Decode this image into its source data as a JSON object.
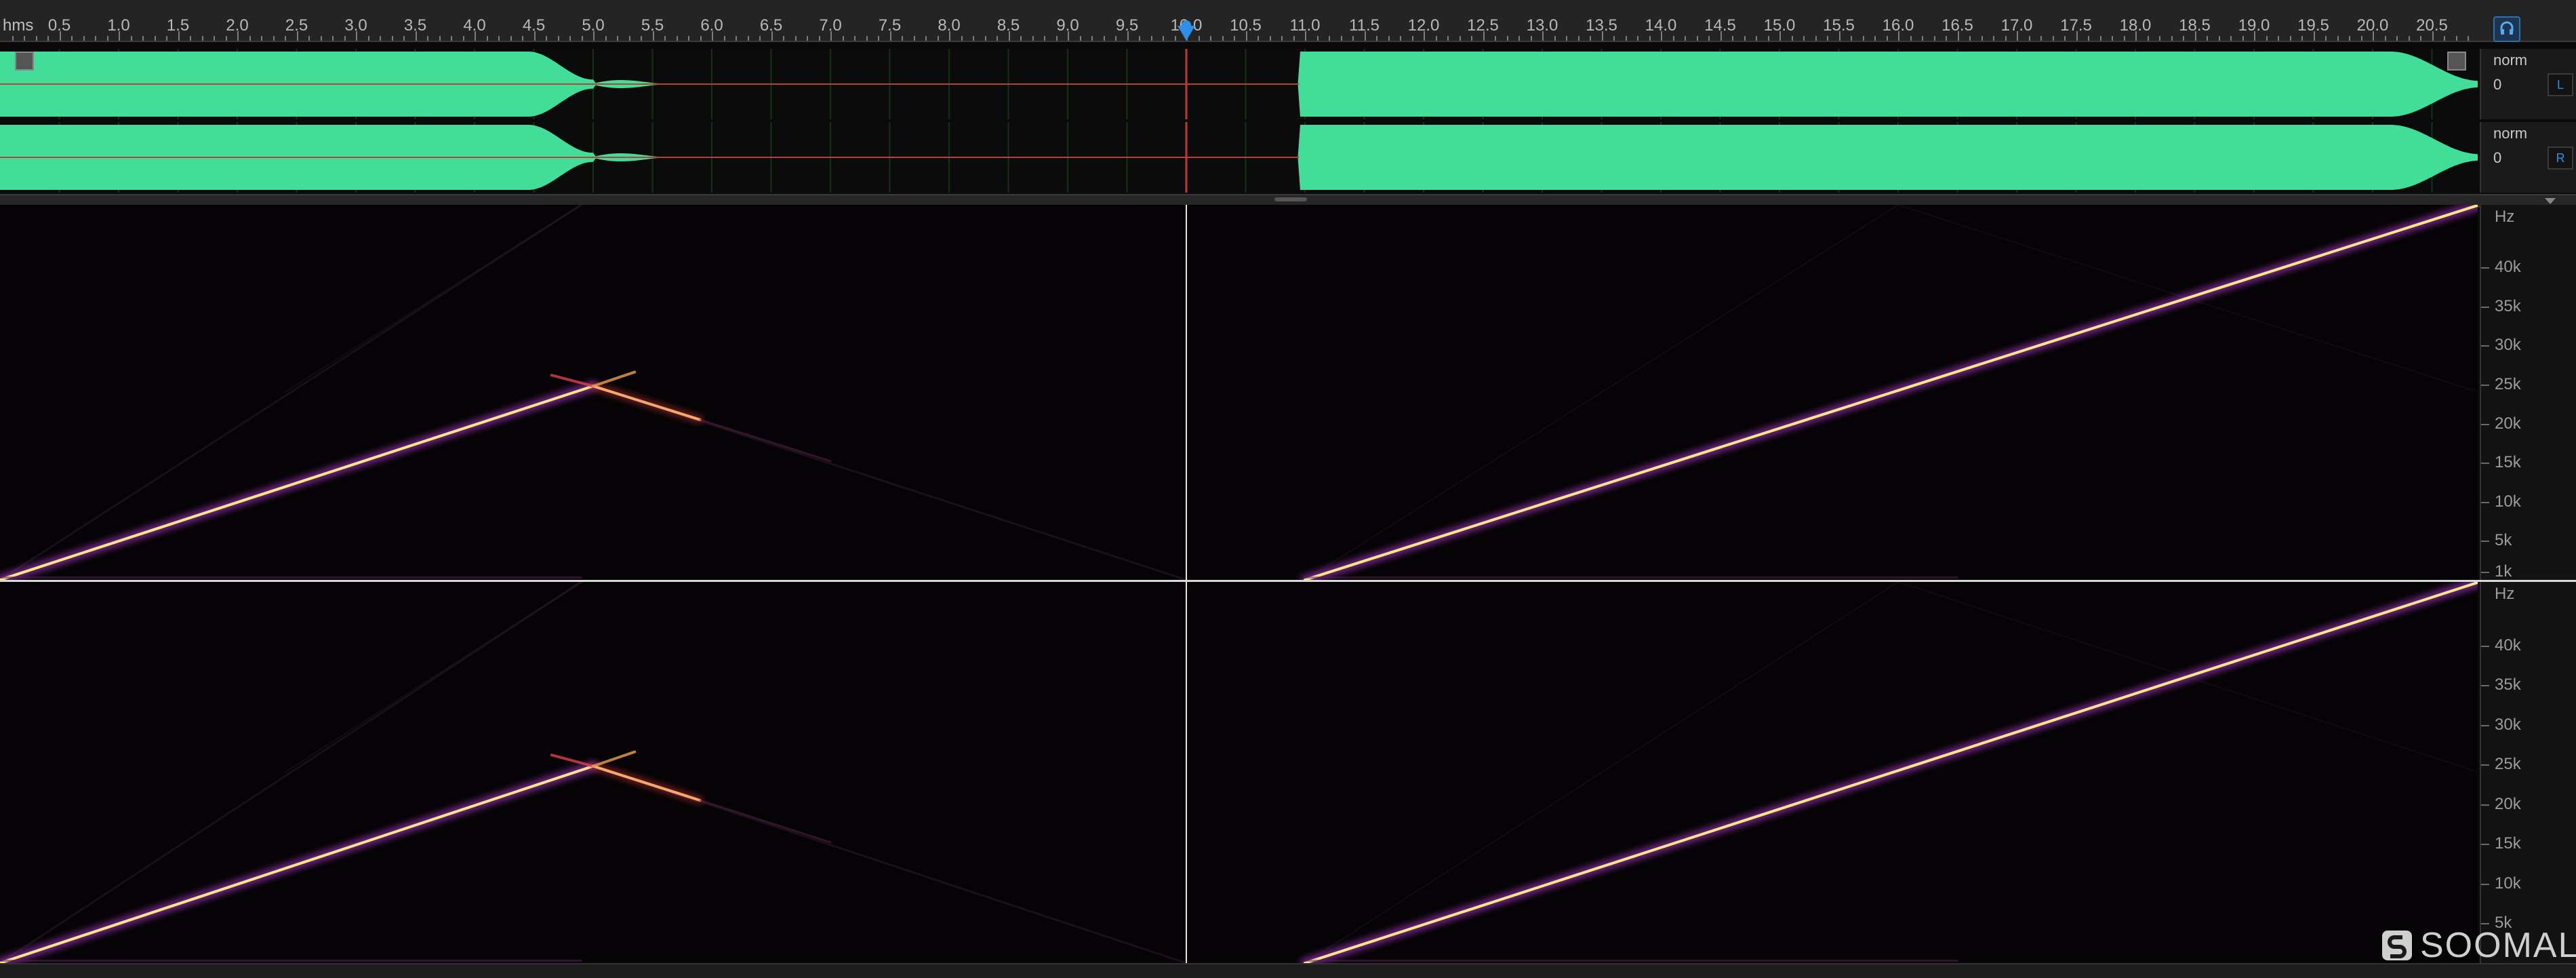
{
  "app": {
    "window": "spectral audio editor",
    "brand_text": "SOOMAL",
    "colors": {
      "background": "#0a0a0a",
      "waveform": "#42dd98",
      "playhead": "#2f8ee8",
      "cursor_line": "#c0392b",
      "sweep_core": "#ffe68a",
      "sweep_glow": "#b53ad6"
    }
  },
  "ruler": {
    "unit": "hms",
    "labels": [
      "0.5",
      "1.0",
      "1.5",
      "2.0",
      "2.5",
      "3.0",
      "3.5",
      "4.0",
      "4.5",
      "5.0",
      "5.5",
      "6.0",
      "6.5",
      "7.0",
      "7.5",
      "8.0",
      "8.5",
      "9.0",
      "9.5",
      "10.0",
      "10.5",
      "11.0",
      "11.5",
      "12.0",
      "12.5",
      "13.0",
      "13.5",
      "14.0",
      "14.5",
      "15.0",
      "15.5",
      "16.0",
      "16.5",
      "17.0",
      "17.5",
      "18.0",
      "18.5",
      "19.0",
      "19.5",
      "20.0",
      "20.5"
    ],
    "playhead_time_s": 10.0,
    "duration_s": 20.9
  },
  "tracks": [
    {
      "channel": "L",
      "norm_label": "norm",
      "zero_label": "0"
    },
    {
      "channel": "R",
      "norm_label": "norm",
      "zero_label": "0"
    }
  ],
  "spectrogram": {
    "unit_label": "Hz",
    "top": {
      "labels": [
        "40k",
        "35k",
        "30k",
        "25k",
        "20k",
        "15k",
        "10k",
        "5k",
        "1k"
      ]
    },
    "bottom": {
      "labels": [
        "40k",
        "35k",
        "30k",
        "25k",
        "20k",
        "15k",
        "10k",
        "5k"
      ]
    }
  },
  "icons": [
    "monitor-headphones-icon",
    "fade-in-icon",
    "fade-out-icon",
    "collapse-arrow-icon",
    "soomal-logo-icon"
  ]
}
